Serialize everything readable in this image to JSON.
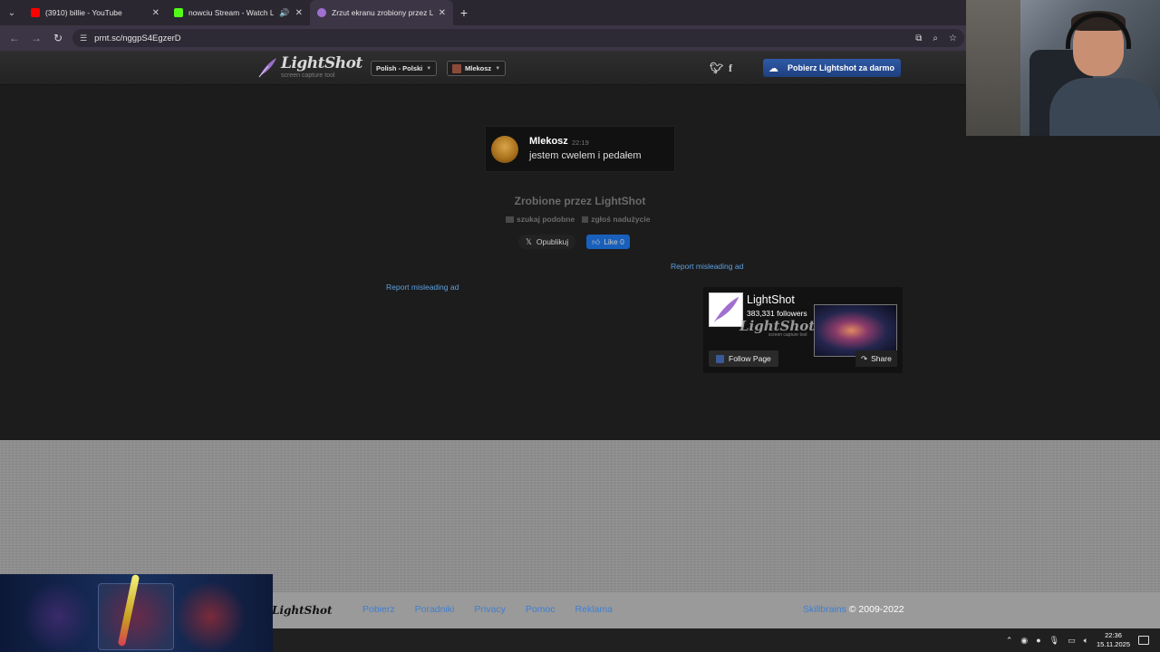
{
  "browser": {
    "tabs": [
      {
        "title": "(3910) billie - YouTube",
        "favicon_color": "#ff0000",
        "active": false
      },
      {
        "title": "nowciu Stream - Watch Live",
        "favicon_color": "#53fc18",
        "active": false
      },
      {
        "title": "Zrzut ekranu zrobiony przez Lightshot",
        "favicon_color": "#a070d0",
        "active": true
      }
    ],
    "url": "prnt.sc/nggpS4EgzerD"
  },
  "header": {
    "logo_name": "LightShot",
    "logo_tagline": "screen capture tool",
    "language_select": "Polish - Polski",
    "user_select": "Mlekosz",
    "download_button": "Pobierz Lightshot za darmo"
  },
  "screenshot": {
    "username": "Mlekosz",
    "time": "22:19",
    "message": "jestem cwelem i pedałem"
  },
  "meta": {
    "made_by": "Zrobione przez LightShot",
    "search_similar": "szukaj podobne",
    "report_abuse": "zgłoś nadużycie",
    "tweet_button": "Opublikuj",
    "like_button": "Like 0",
    "report_ad_right": "Report misleading ad",
    "report_ad_left": "Report misleading ad"
  },
  "fb_widget": {
    "page_name": "LightShot",
    "followers": "383,331 followers",
    "watermark": "LightShot",
    "watermark_tag": "screen capture tool",
    "follow_button": "Follow Page",
    "share_button": "Share"
  },
  "footer": {
    "logo": "LightShot",
    "links": [
      "Pobierz",
      "Poradniki",
      "Privacy",
      "Pomoc",
      "Reklama"
    ],
    "company": "Skillbrains",
    "copyright": "© 2009-2022"
  },
  "taskbar": {
    "time": "22:36",
    "date": "15.11.2025"
  }
}
